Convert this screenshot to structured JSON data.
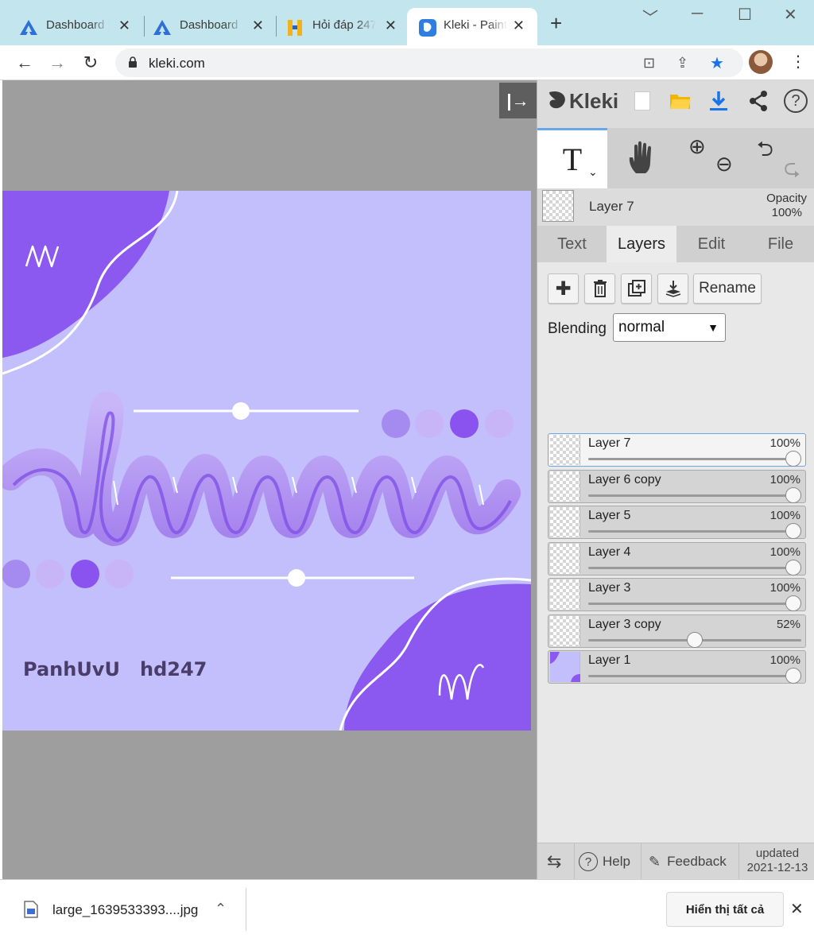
{
  "browser": {
    "tabs": [
      {
        "label": "Dashboard |",
        "icon": "atlassian-icon"
      },
      {
        "label": "Dashboard -",
        "icon": "atlassian-icon"
      },
      {
        "label": "Hỏi đáp 247",
        "icon": "hoidap-icon"
      },
      {
        "label": "Kleki - Paint",
        "icon": "kleki-icon",
        "active": true
      }
    ],
    "new_tab": "+",
    "url": "kleki.com"
  },
  "kleki": {
    "brand": "Kleki",
    "current_tool": "T",
    "current_layer": "Layer 7",
    "opacity_label": "Opacity",
    "opacity_value": "100%",
    "tabs": [
      "Text",
      "Layers",
      "Edit",
      "File"
    ],
    "active_tab": "Layers",
    "rename_label": "Rename",
    "blending_label": "Blending",
    "blending_value": "normal",
    "layers": [
      {
        "name": "Layer 7",
        "opacity": "100%",
        "level": 1.0,
        "selected": true
      },
      {
        "name": "Layer 6 copy",
        "opacity": "100%",
        "level": 1.0
      },
      {
        "name": "Layer 5",
        "opacity": "100%",
        "level": 1.0
      },
      {
        "name": "Layer 4",
        "opacity": "100%",
        "level": 1.0
      },
      {
        "name": "Layer 3",
        "opacity": "100%",
        "level": 1.0
      },
      {
        "name": "Layer 3 copy",
        "opacity": "52%",
        "level": 0.52
      },
      {
        "name": "Layer 1",
        "opacity": "100%",
        "level": 1.0
      }
    ],
    "footer": {
      "help": "Help",
      "feedback": "Feedback",
      "updated_label": "updated",
      "updated_date": "2021-12-13"
    }
  },
  "artwork": {
    "signature": "PanhUvU   hd247",
    "colors": {
      "background": "#c2bffc",
      "accent": "#8b58f0",
      "light": "#b9a0f3",
      "mid": "#a88aef"
    }
  },
  "download": {
    "filename": "large_1639533393....jpg",
    "show_all": "Hiển thị tất cả"
  }
}
